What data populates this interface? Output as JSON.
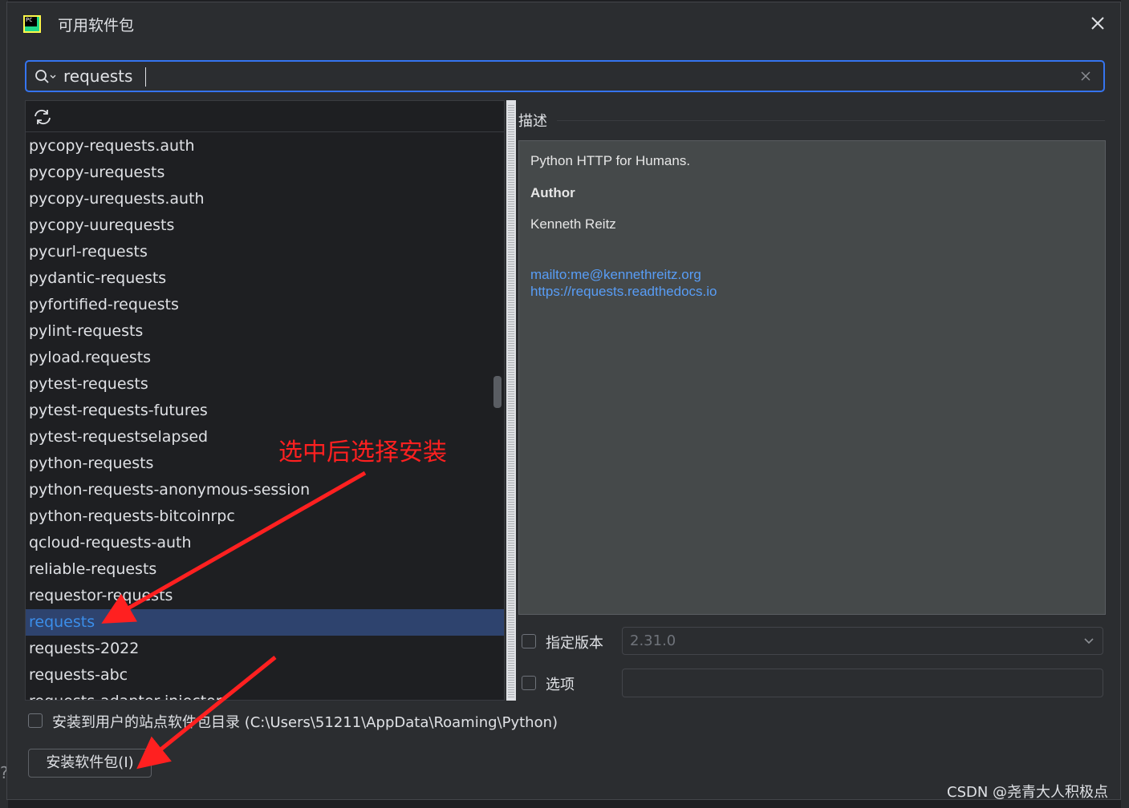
{
  "dialog": {
    "title": "可用软件包",
    "app_icon_text": "PC"
  },
  "search": {
    "value": "requests",
    "placeholder": ""
  },
  "packages": [
    "pycopy-requests.auth",
    "pycopy-urequests",
    "pycopy-urequests.auth",
    "pycopy-uurequests",
    "pycurl-requests",
    "pydantic-requests",
    "pyfortified-requests",
    "pylint-requests",
    "pyload.requests",
    "pytest-requests",
    "pytest-requests-futures",
    "pytest-requestselapsed",
    "python-requests",
    "python-requests-anonymous-session",
    "python-requests-bitcoinrpc",
    "qcloud-requests-auth",
    "reliable-requests",
    "requestor-requests",
    "requests",
    "requests-2022",
    "requests-abc",
    "requests-adapter-injector"
  ],
  "selected_package": "requests",
  "description": {
    "label": "描述",
    "summary": "Python HTTP for Humans.",
    "author_heading": "Author",
    "author_name": "Kenneth Reitz",
    "email_link": "mailto:me@kennethreitz.org",
    "homepage_link": "https://requests.readthedocs.io"
  },
  "version": {
    "checkbox_label": "指定版本",
    "checked": false,
    "value": "2.31.0"
  },
  "options": {
    "checkbox_label": "选项",
    "checked": false,
    "value": ""
  },
  "user_site": {
    "checkbox_label": "安装到用户的站点软件包目录 (C:\\Users\\51211\\AppData\\Roaming\\Python)",
    "checked": false
  },
  "install_button": {
    "label": "安装软件包(I)"
  },
  "annotation": {
    "text": "选中后选择安装",
    "color": "#ff2020"
  },
  "watermark": "CSDN @尧青大人积极点",
  "colors": {
    "accent": "#3574f0",
    "selection_bg": "#2e436e",
    "link": "#589df6"
  }
}
